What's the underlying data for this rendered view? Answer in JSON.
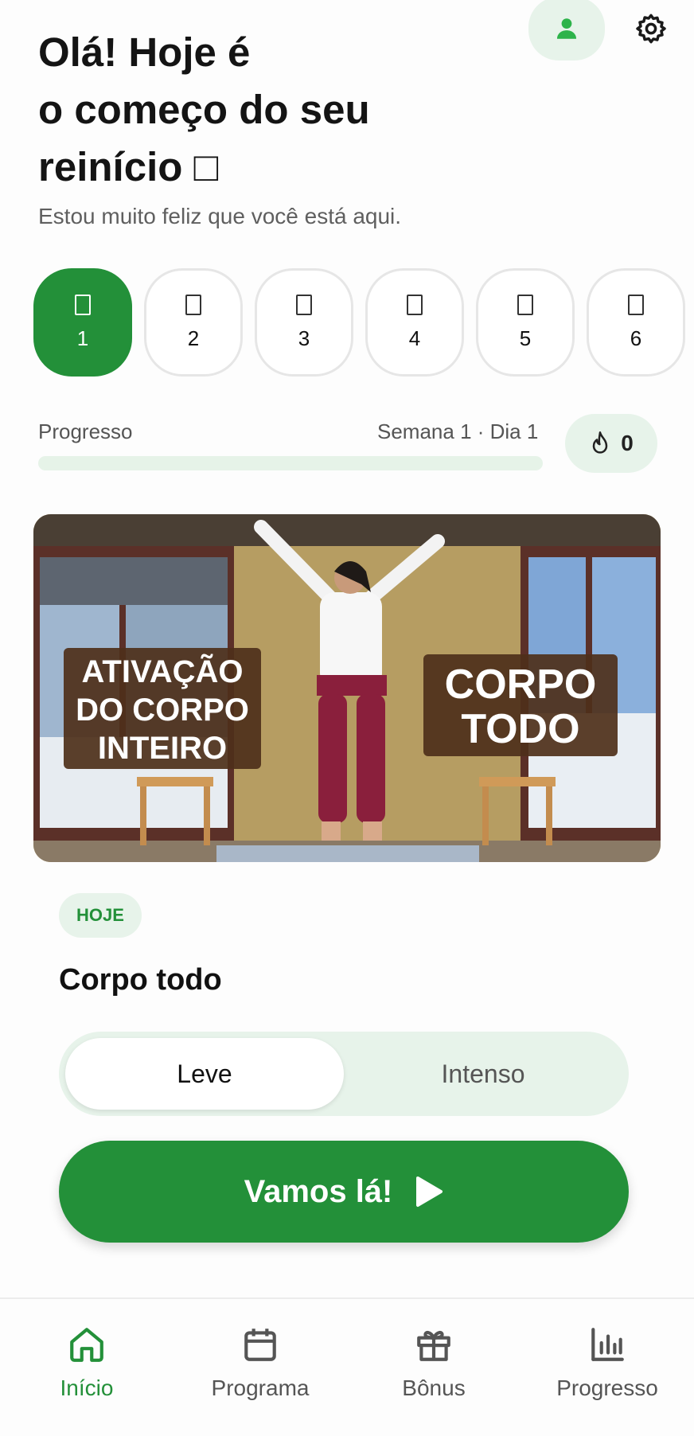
{
  "header": {
    "title_lines": [
      "Olá! Hoje é",
      "o começo do seu",
      "reinício □"
    ],
    "subtitle": "Estou muito feliz que você está aqui."
  },
  "days": [
    {
      "label": "1",
      "active": true
    },
    {
      "label": "2",
      "active": false
    },
    {
      "label": "3",
      "active": false
    },
    {
      "label": "4",
      "active": false
    },
    {
      "label": "5",
      "active": false
    },
    {
      "label": "6",
      "active": false
    }
  ],
  "progress": {
    "label": "Progresso",
    "week_day": "Semana 1 · Dia 1",
    "value": 0,
    "streak_count": "0"
  },
  "video": {
    "left_text": [
      "ATIVAÇÃO",
      "DO CORPO",
      "INTEIRO"
    ],
    "right_text": [
      "CORPO",
      "TODO"
    ]
  },
  "today": {
    "badge": "HOJE",
    "title": "Corpo todo",
    "options": [
      "Leve",
      "Intenso"
    ],
    "selected": "Leve",
    "cta_label": "Vamos lá!"
  },
  "nav": [
    {
      "label": "Início",
      "icon": "home-icon",
      "active": true
    },
    {
      "label": "Programa",
      "icon": "calendar-icon",
      "active": false
    },
    {
      "label": "Bônus",
      "icon": "gift-icon",
      "active": false
    },
    {
      "label": "Progresso",
      "icon": "bar-chart-icon",
      "active": false
    }
  ],
  "colors": {
    "accent": "#239039",
    "accent_light": "#e7f3ea",
    "text": "#111111",
    "muted": "#555555"
  }
}
